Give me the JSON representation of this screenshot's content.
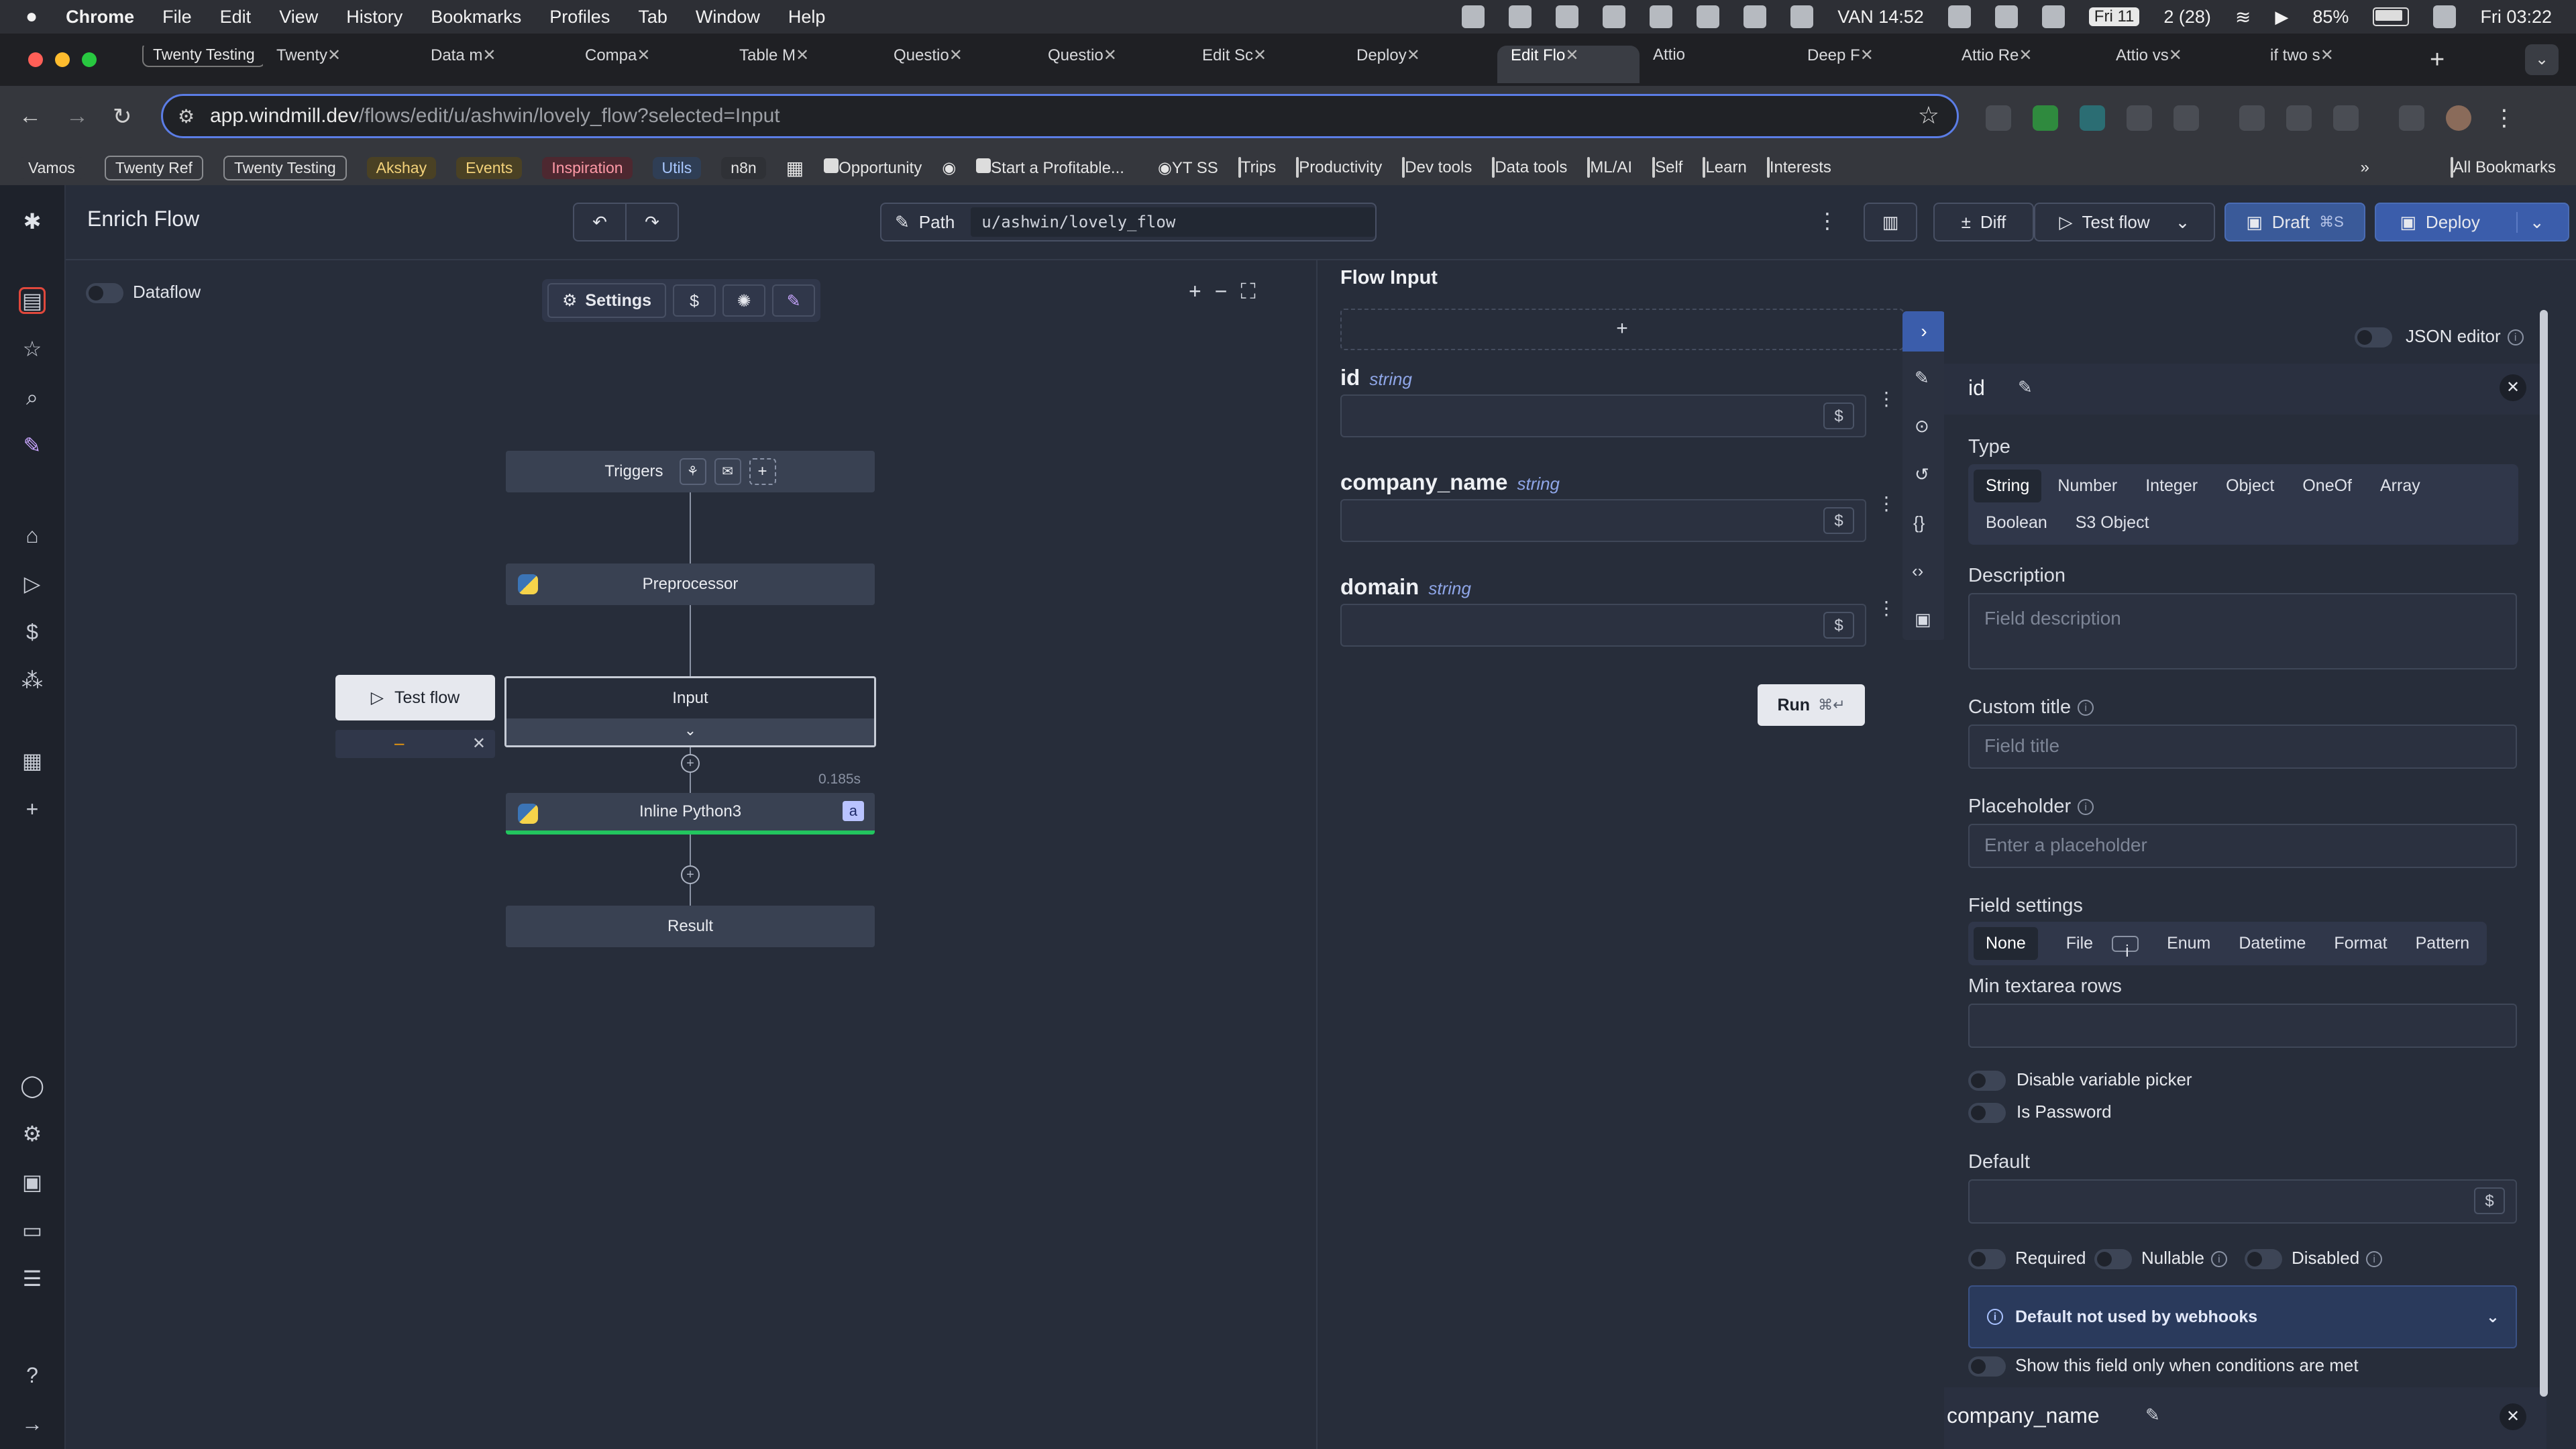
{
  "menubar": {
    "items": [
      "Chrome",
      "File",
      "Edit",
      "View",
      "History",
      "Bookmarks",
      "Profiles",
      "Tab",
      "Window",
      "Help"
    ],
    "status": {
      "location": "VAN 14:52",
      "date_badge": "Fri 11",
      "badge_count": "2 (28)",
      "battery": "85%",
      "clock": "Fri 03:22"
    }
  },
  "tabs": [
    {
      "label": "Twenty Testing",
      "kind": "pill"
    },
    {
      "label": "Twenty"
    },
    {
      "label": "Data m"
    },
    {
      "label": "Compa"
    },
    {
      "label": "Table M"
    },
    {
      "label": "Questio"
    },
    {
      "label": "Questio"
    },
    {
      "label": "Edit Sc"
    },
    {
      "label": "Deploy"
    },
    {
      "label": "Edit Flo",
      "active": true
    },
    {
      "label": "Attio"
    },
    {
      "label": "Deep F"
    },
    {
      "label": "Attio Re"
    },
    {
      "label": "Attio vs"
    },
    {
      "label": "if two s"
    }
  ],
  "address": {
    "host": "app.windmill.dev",
    "path": "/flows/edit/u/ashwin/lovely_flow?selected=Input"
  },
  "bookmarks": {
    "badges": [
      {
        "label": "Vamos",
        "bg": "#35373d",
        "fg": "#e5e5e5"
      },
      {
        "label": "Twenty Ref",
        "bg": "#35373d",
        "fg": "#e5e5e5",
        "border": true
      },
      {
        "label": "Twenty Testing",
        "bg": "#35373d",
        "fg": "#e5e5e5",
        "border": true
      },
      {
        "label": "Akshay",
        "bg": "#4a4124",
        "fg": "#f3d27a"
      },
      {
        "label": "Events",
        "bg": "#4a4124",
        "fg": "#f3d27a"
      },
      {
        "label": "Inspiration",
        "bg": "#4d2830",
        "fg": "#ff9aa7"
      },
      {
        "label": "Utils",
        "bg": "#2f3e55",
        "fg": "#a9c8ff"
      },
      {
        "label": "n8n",
        "bg": "#2f3136",
        "fg": "#e5e5e5"
      }
    ],
    "items": [
      "Opportunity",
      "Start a Profitable...",
      "YT SS",
      "Trips",
      "Productivity",
      "Dev tools",
      "Data tools",
      "ML/AI",
      "Self",
      "Learn",
      "Interests"
    ],
    "all": "All Bookmarks"
  },
  "header": {
    "title": "Enrich Flow",
    "path_label": "Path",
    "path_value": "u/ashwin/lovely_flow",
    "diff": "Diff",
    "test_flow": "Test flow",
    "draft": "Draft",
    "draft_shortcut": "⌘S",
    "deploy": "Deploy"
  },
  "canvas": {
    "dataflow": "Dataflow",
    "settings": "Settings",
    "nodes": {
      "triggers": "Triggers",
      "preprocessor": "Preprocessor",
      "input": "Input",
      "python": "Inline Python3",
      "result": "Result",
      "python_badge": "a",
      "timing": "0.185s"
    },
    "test_flow": "Test flow",
    "test_status": "–"
  },
  "flow_input": {
    "title": "Flow Input",
    "fields": [
      {
        "name": "id",
        "type": "string"
      },
      {
        "name": "company_name",
        "type": "string"
      },
      {
        "name": "domain",
        "type": "string"
      }
    ],
    "run": "Run",
    "run_shortcut": "⌘↵"
  },
  "editor": {
    "json_editor": "JSON editor",
    "field_name": "id",
    "type_label": "Type",
    "types": [
      "String",
      "Number",
      "Integer",
      "Object",
      "OneOf",
      "Array",
      "Boolean",
      "S3 Object"
    ],
    "selected_type": "String",
    "description_label": "Description",
    "description_placeholder": "Field description",
    "custom_title_label": "Custom title",
    "custom_title_placeholder": "Field title",
    "placeholder_label": "Placeholder",
    "placeholder_placeholder": "Enter a placeholder",
    "field_settings_label": "Field settings",
    "field_settings": [
      "None",
      "File",
      "Enum",
      "Datetime",
      "Format",
      "Pattern"
    ],
    "min_rows_label": "Min textarea rows",
    "disable_picker": "Disable variable picker",
    "is_password": "Is Password",
    "default_label": "Default",
    "required": "Required",
    "nullable": "Nullable",
    "disabled": "Disabled",
    "webhook_note": "Default not used by webhooks",
    "show_conditional": "Show this field only when conditions are met",
    "next_field": "company_name"
  },
  "colors": {
    "accent": "#5b7de6",
    "primary_btn": "#3b5dab",
    "success": "#22c55e"
  }
}
